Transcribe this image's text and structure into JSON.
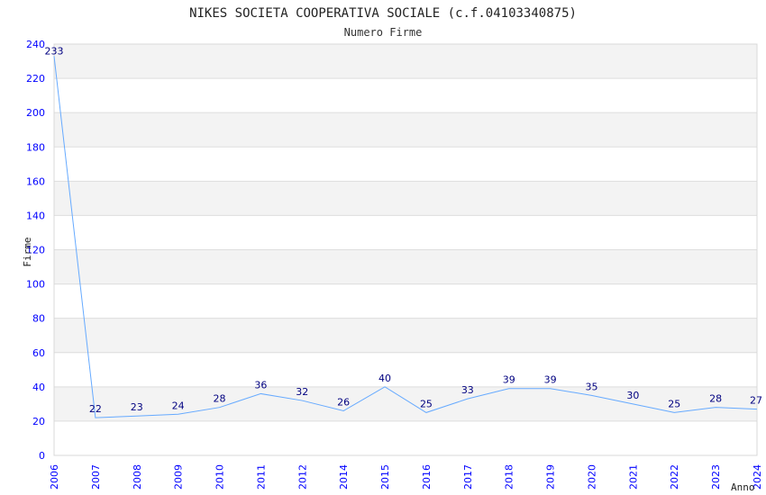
{
  "chart_data": {
    "type": "line",
    "title": "NIKES SOCIETA COOPERATIVA SOCIALE (c.f.04103340875)",
    "subtitle": "Numero Firme",
    "xlabel": "Anno",
    "ylabel": "Firme",
    "categories": [
      "2006",
      "2007",
      "2008",
      "2009",
      "2010",
      "2011",
      "2012",
      "2014",
      "2015",
      "2016",
      "2017",
      "2018",
      "2019",
      "2020",
      "2021",
      "2022",
      "2023",
      "2024"
    ],
    "values": [
      233,
      22,
      23,
      24,
      28,
      36,
      32,
      26,
      40,
      25,
      33,
      39,
      39,
      35,
      30,
      25,
      28,
      27
    ],
    "ylim": [
      0,
      240
    ],
    "yticks": [
      0,
      20,
      40,
      60,
      80,
      100,
      120,
      140,
      160,
      180,
      200,
      220,
      240
    ],
    "grid": true,
    "banded_background": true,
    "colors": {
      "line": "#66aaff",
      "tick_labels": "#0000ff",
      "data_labels": "#000080",
      "band": "#f3f3f3"
    }
  }
}
